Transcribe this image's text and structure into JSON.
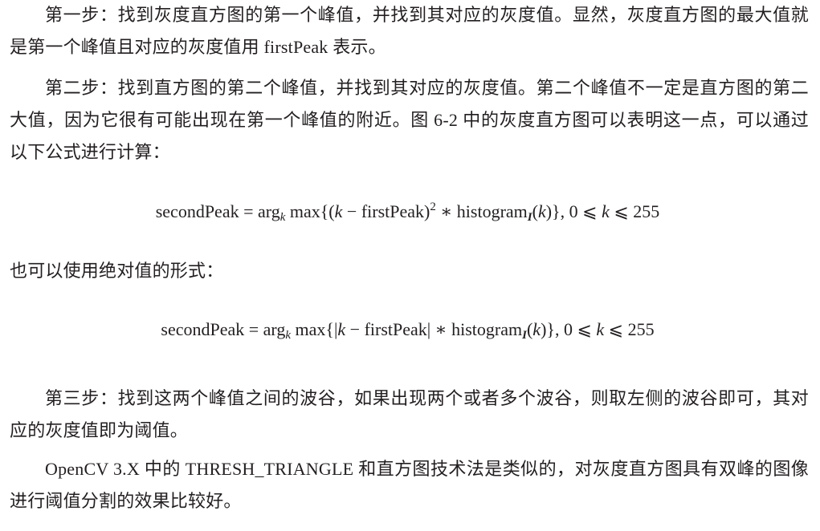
{
  "paragraphs": {
    "p1": "第一步：找到灰度直方图的第一个峰值，并找到其对应的灰度值。显然，灰度直方图的最大值就是第一个峰值且对应的灰度值用 firstPeak 表示。",
    "p2": "第二步：找到直方图的第二个峰值，并找到其对应的灰度值。第二个峰值不一定是直方图的第二大值，因为它很有可能出现在第一个峰值的附近。图 6-2 中的灰度直方图可以表明这一点，可以通过以下公式进行计算：",
    "p3": "也可以使用绝对值的形式：",
    "p4": "第三步：找到这两个峰值之间的波谷，如果出现两个或者多个波谷，则取左侧的波谷即可，其对应的灰度值即为阈值。",
    "p5": "OpenCV 3.X 中的 THRESH_TRIANGLE 和直方图技术法是类似的，对灰度直方图具有双峰的图像进行阈值分割的效果比较好。"
  },
  "formula1": {
    "lhs": "secondPeak = arg",
    "sub_k": "k",
    "max_open": " max{(",
    "var_k": "k",
    "minus_first": " − firstPeak)",
    "sup_2": "2",
    "times_hist": " ∗ histogram",
    "sub_I": "I",
    "paren_open": "(",
    "var_k2": "k",
    "close_range": ")}, 0 ⩽ ",
    "var_k3": "k",
    "upper": " ⩽ 255"
  },
  "formula2": {
    "lhs": "secondPeak = arg",
    "sub_k": "k",
    "max_open": " max{|",
    "var_k": "k",
    "minus_first": " − firstPeak| ∗ histogram",
    "sub_I": "I",
    "paren_open": "(",
    "var_k2": "k",
    "close_range": ")}, 0 ⩽ ",
    "var_k3": "k",
    "upper": " ⩽ 255"
  }
}
